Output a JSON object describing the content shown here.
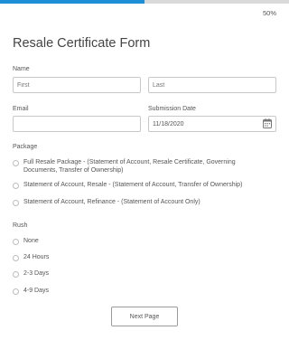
{
  "progress": {
    "percent": 50,
    "label": "50%"
  },
  "form": {
    "title": "Resale Certificate Form",
    "name": {
      "label": "Name",
      "first_placeholder": "First",
      "last_placeholder": "Last"
    },
    "email": {
      "label": "Email",
      "value": ""
    },
    "submission_date": {
      "label": "Submission Date",
      "value": "11/18/2020",
      "icon": "calendar-icon"
    },
    "package": {
      "label": "Package",
      "options": [
        {
          "label": "Full Resale Package - (Statement of Account, Resale Certificate, Governing Documents, Transfer of Ownership)",
          "selected": false
        },
        {
          "label": "Statement of Account, Resale - (Statement of Account, Transfer of Ownership)",
          "selected": false
        },
        {
          "label": "Statement of Account, Refinance - (Statement of Account Only)",
          "selected": false
        }
      ]
    },
    "rush": {
      "label": "Rush",
      "options": [
        {
          "label": "None",
          "selected": false
        },
        {
          "label": "24 Hours",
          "selected": false
        },
        {
          "label": "2-3 Days",
          "selected": false
        },
        {
          "label": "4-9 Days",
          "selected": false
        }
      ]
    },
    "next_button": "Next Page"
  },
  "colors": {
    "accent": "#1e8fd6",
    "track": "#d9d9d9",
    "border": "#c9c9c9",
    "text": "#555555"
  }
}
